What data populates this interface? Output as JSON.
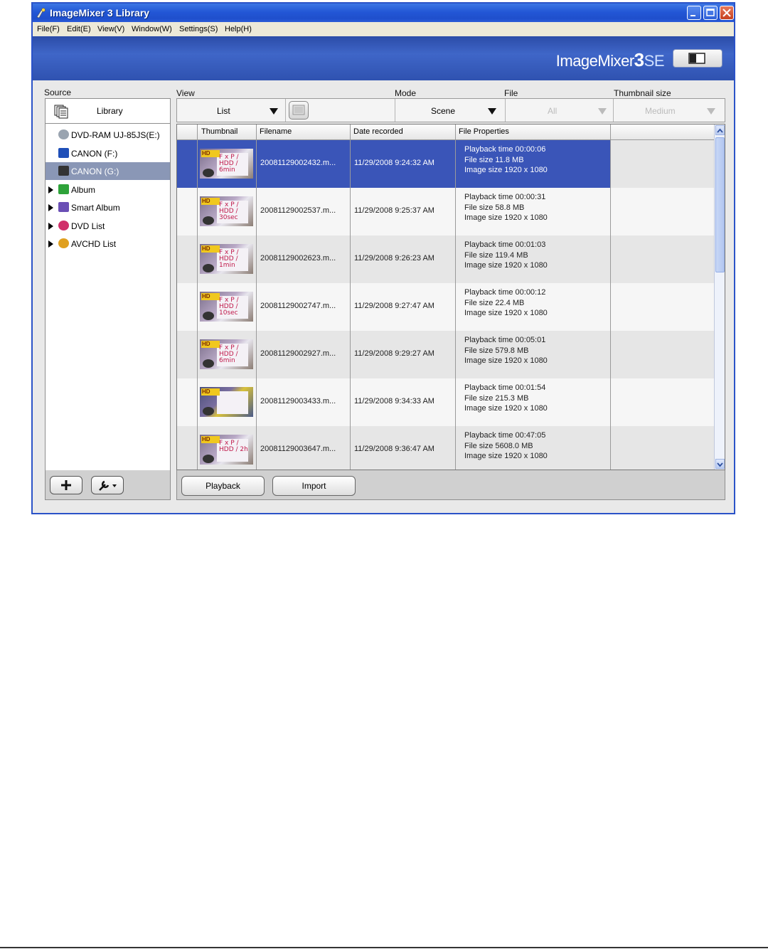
{
  "window": {
    "title": "ImageMixer 3 Library"
  },
  "menu": [
    "File(F)",
    "Edit(E)",
    "View(V)",
    "Window(W)",
    "Settings(S)",
    "Help(H)"
  ],
  "banner": {
    "logo_main": "ImageMixer",
    "logo_num": "3",
    "logo_se": "SE"
  },
  "source": {
    "label": "Source",
    "library": "Library",
    "items": [
      {
        "label": "DVD-RAM UJ-85JS(E:)",
        "icon": "optical-drive-icon",
        "expand": false,
        "selected": false
      },
      {
        "label": "CANON (F:)",
        "icon": "memory-card-icon",
        "expand": false,
        "selected": false
      },
      {
        "label": "CANON (G:)",
        "icon": "camcorder-drive-icon",
        "expand": false,
        "selected": true
      },
      {
        "label": "Album",
        "icon": "album-icon",
        "expand": true,
        "selected": false
      },
      {
        "label": "Smart Album",
        "icon": "smart-album-icon",
        "expand": true,
        "selected": false
      },
      {
        "label": "DVD List",
        "icon": "dvd-icon",
        "expand": true,
        "selected": false
      },
      {
        "label": "AVCHD List",
        "icon": "avchd-icon",
        "expand": true,
        "selected": false
      }
    ]
  },
  "toolbar": {
    "view_label": "View",
    "view_value": "List",
    "mode_label": "Mode",
    "mode_value": "Scene",
    "file_label": "File",
    "file_value": "All",
    "thumb_label": "Thumbnail size",
    "thumb_value": "Medium"
  },
  "columns": [
    "Thumbnail",
    "Filename",
    "Date recorded",
    "File Properties"
  ],
  "rows": [
    {
      "filename": "20081129002432.m...",
      "date": "11/29/2008 9:24:32 AM",
      "playback": "Playback time 00:00:06",
      "size": "File size 11.8 MB",
      "image": "Image size 1920 x 1080",
      "thumb_text": "F x P / HDD / 6min",
      "selected": true
    },
    {
      "filename": "20081129002537.m...",
      "date": "11/29/2008 9:25:37 AM",
      "playback": "Playback time 00:00:31",
      "size": "File size 58.8 MB",
      "image": "Image size 1920 x 1080",
      "thumb_text": "F x P / HDD / 30sec",
      "selected": false
    },
    {
      "filename": "20081129002623.m...",
      "date": "11/29/2008 9:26:23 AM",
      "playback": "Playback time 00:01:03",
      "size": "File size 119.4 MB",
      "image": "Image size 1920 x 1080",
      "thumb_text": "F x P / HDD / 1min",
      "selected": false
    },
    {
      "filename": "20081129002747.m...",
      "date": "11/29/2008 9:27:47 AM",
      "playback": "Playback time 00:00:12",
      "size": "File size 22.4 MB",
      "image": "Image size 1920 x 1080",
      "thumb_text": "F x P / HDD / 10sec",
      "selected": false
    },
    {
      "filename": "20081129002927.m...",
      "date": "11/29/2008 9:29:27 AM",
      "playback": "Playback time 00:05:01",
      "size": "File size 579.8 MB",
      "image": "Image size 1920 x 1080",
      "thumb_text": "F x P / HDD / 6min",
      "selected": false
    },
    {
      "filename": "20081129003433.m...",
      "date": "11/29/2008 9:34:33 AM",
      "playback": "Playback time 00:01:54",
      "size": "File size 215.3 MB",
      "image": "Image size 1920 x 1080",
      "thumb_text": "",
      "selected": false
    },
    {
      "filename": "20081129003647.m...",
      "date": "11/29/2008 9:36:47 AM",
      "playback": "Playback time 00:47:05",
      "size": "File size 5608.0 MB",
      "image": "Image size 1920 x 1080",
      "thumb_text": "F x P / HDD / 2h",
      "selected": false
    }
  ],
  "buttons": {
    "playback": "Playback",
    "import": "Import"
  },
  "colors": {
    "selection": "#3a55b8",
    "row_alt": "#e6e6e6",
    "titlebar": "#2357d6",
    "banner": "#3557b6"
  }
}
